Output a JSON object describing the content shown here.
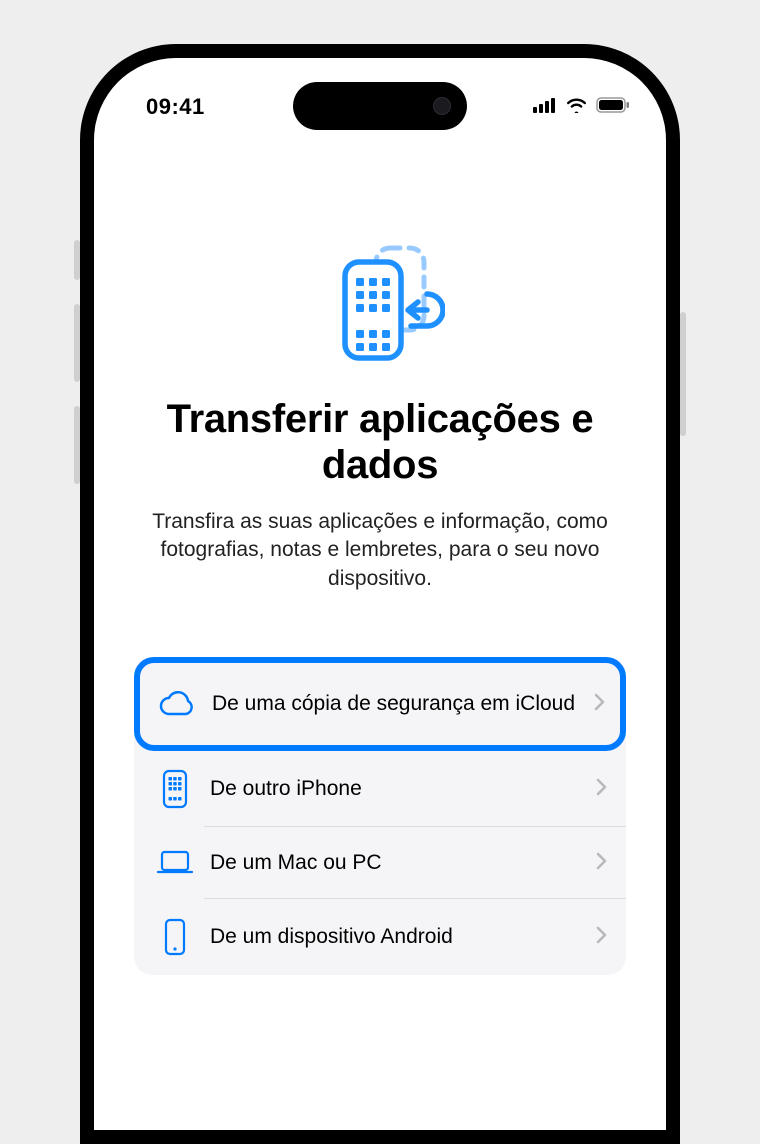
{
  "statusBar": {
    "time": "09:41"
  },
  "page": {
    "title": "Transferir aplicações e dados",
    "subtitle": "Transfira as suas aplicações e informação, como fotografias, notas e lembretes, para o seu novo dispositivo."
  },
  "options": [
    {
      "label": "De uma cópia de segurança em iCloud",
      "icon": "cloud",
      "highlighted": true
    },
    {
      "label": "De outro iPhone",
      "icon": "iphone-grid",
      "highlighted": false
    },
    {
      "label": "De um Mac ou PC",
      "icon": "laptop",
      "highlighted": false
    },
    {
      "label": "De um dispositivo Android",
      "icon": "android-phone",
      "highlighted": false
    }
  ]
}
